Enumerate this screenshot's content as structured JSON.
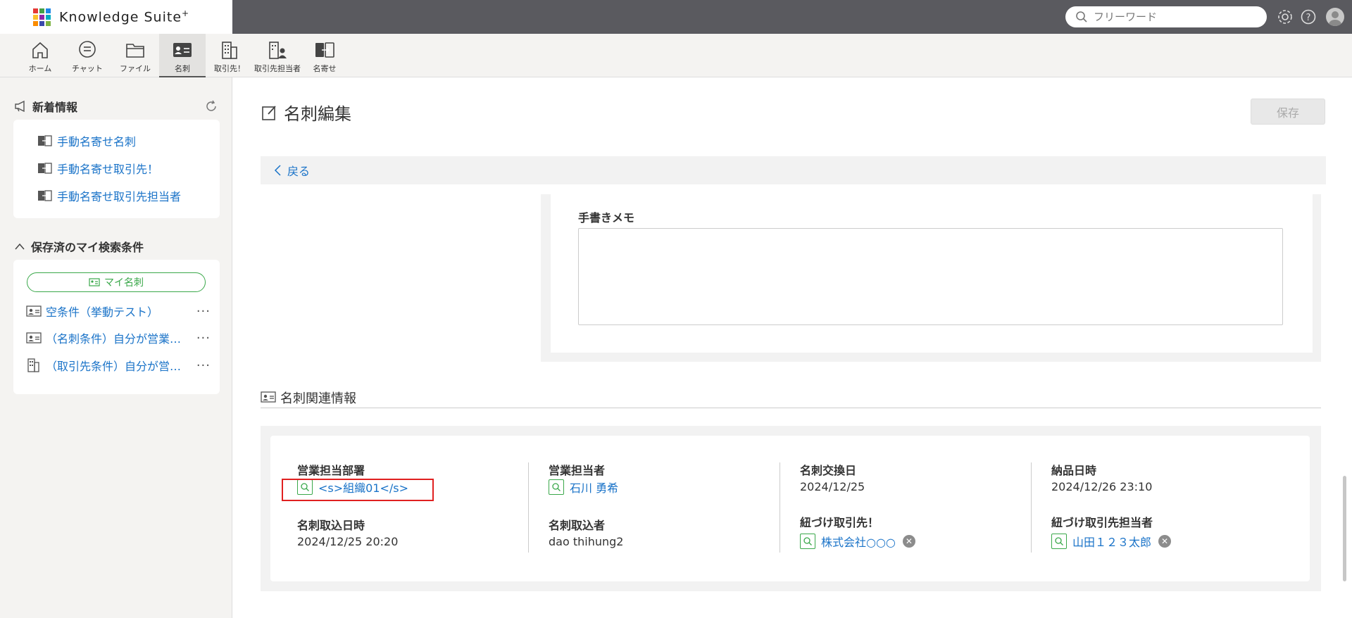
{
  "app": {
    "logo_text": "Knowledge Suite",
    "logo_sup": "+",
    "logo_colors": [
      "#e53935",
      "#43a047",
      "#1e88e5",
      "#fbc02d",
      "#8e24aa",
      "#00acc1",
      "#fb8c00",
      "#3949ab",
      "#7cb342"
    ]
  },
  "header": {
    "search_placeholder": "フリーワード",
    "icons": [
      "gear-icon",
      "help-icon",
      "avatar"
    ]
  },
  "nav": {
    "items": [
      {
        "label": "ホーム",
        "icon": "home-icon"
      },
      {
        "label": "チャット",
        "icon": "chat-icon"
      },
      {
        "label": "ファイル",
        "icon": "folder-icon"
      },
      {
        "label": "名刺",
        "icon": "business-card-icon",
        "active": true
      },
      {
        "label": "取引先！",
        "icon": "building-icon"
      },
      {
        "label": "取引先担当者",
        "icon": "contact-building-icon"
      },
      {
        "label": "名寄せ",
        "icon": "merge-icon"
      }
    ]
  },
  "sidebar": {
    "news_title": "新着情報",
    "news_links": [
      "手動名寄せ名刺",
      "手動名寄せ取引先！",
      "手動名寄せ取引先担当者"
    ],
    "saved_title": "保存済のマイ検索条件",
    "my_card_button": "マイ名刺",
    "conditions": [
      {
        "label": "空条件（挙動テスト）",
        "icon": "card-icon"
      },
      {
        "label": "（名刺条件）自分が営業担当",
        "icon": "card-icon"
      },
      {
        "label": "（取引先条件）自分が営業担当",
        "icon": "building-icon"
      }
    ],
    "more_label": "···"
  },
  "main": {
    "page_title": "名刺編集",
    "save_label": "保存",
    "back_label": "戻る",
    "memo_label": "手書きメモ",
    "memo_value": "",
    "related_title": "名刺関連情報",
    "related": {
      "dept_label": "営業担当部署",
      "dept_value": "<s>組織01</s>",
      "import_date_label": "名刺取込日時",
      "import_date_value": "2024/12/25 20:20",
      "rep_label": "営業担当者",
      "rep_value": "石川 勇希",
      "importer_label": "名刺取込者",
      "importer_value": "dao thihung2",
      "exchange_label": "名刺交換日",
      "exchange_value": "2024/12/25",
      "client_label": "紐づけ取引先！",
      "client_value": "株式会社○○○",
      "delivery_label": "納品日時",
      "delivery_value": "2024/12/26 23:10",
      "contact_label": "紐づけ取引先担当者",
      "contact_value": "山田１２３太郎"
    }
  },
  "colors": {
    "topbar": "#5a5a5f",
    "link": "#1a73c8",
    "green": "#3aa84a",
    "highlight": "#e02020"
  }
}
